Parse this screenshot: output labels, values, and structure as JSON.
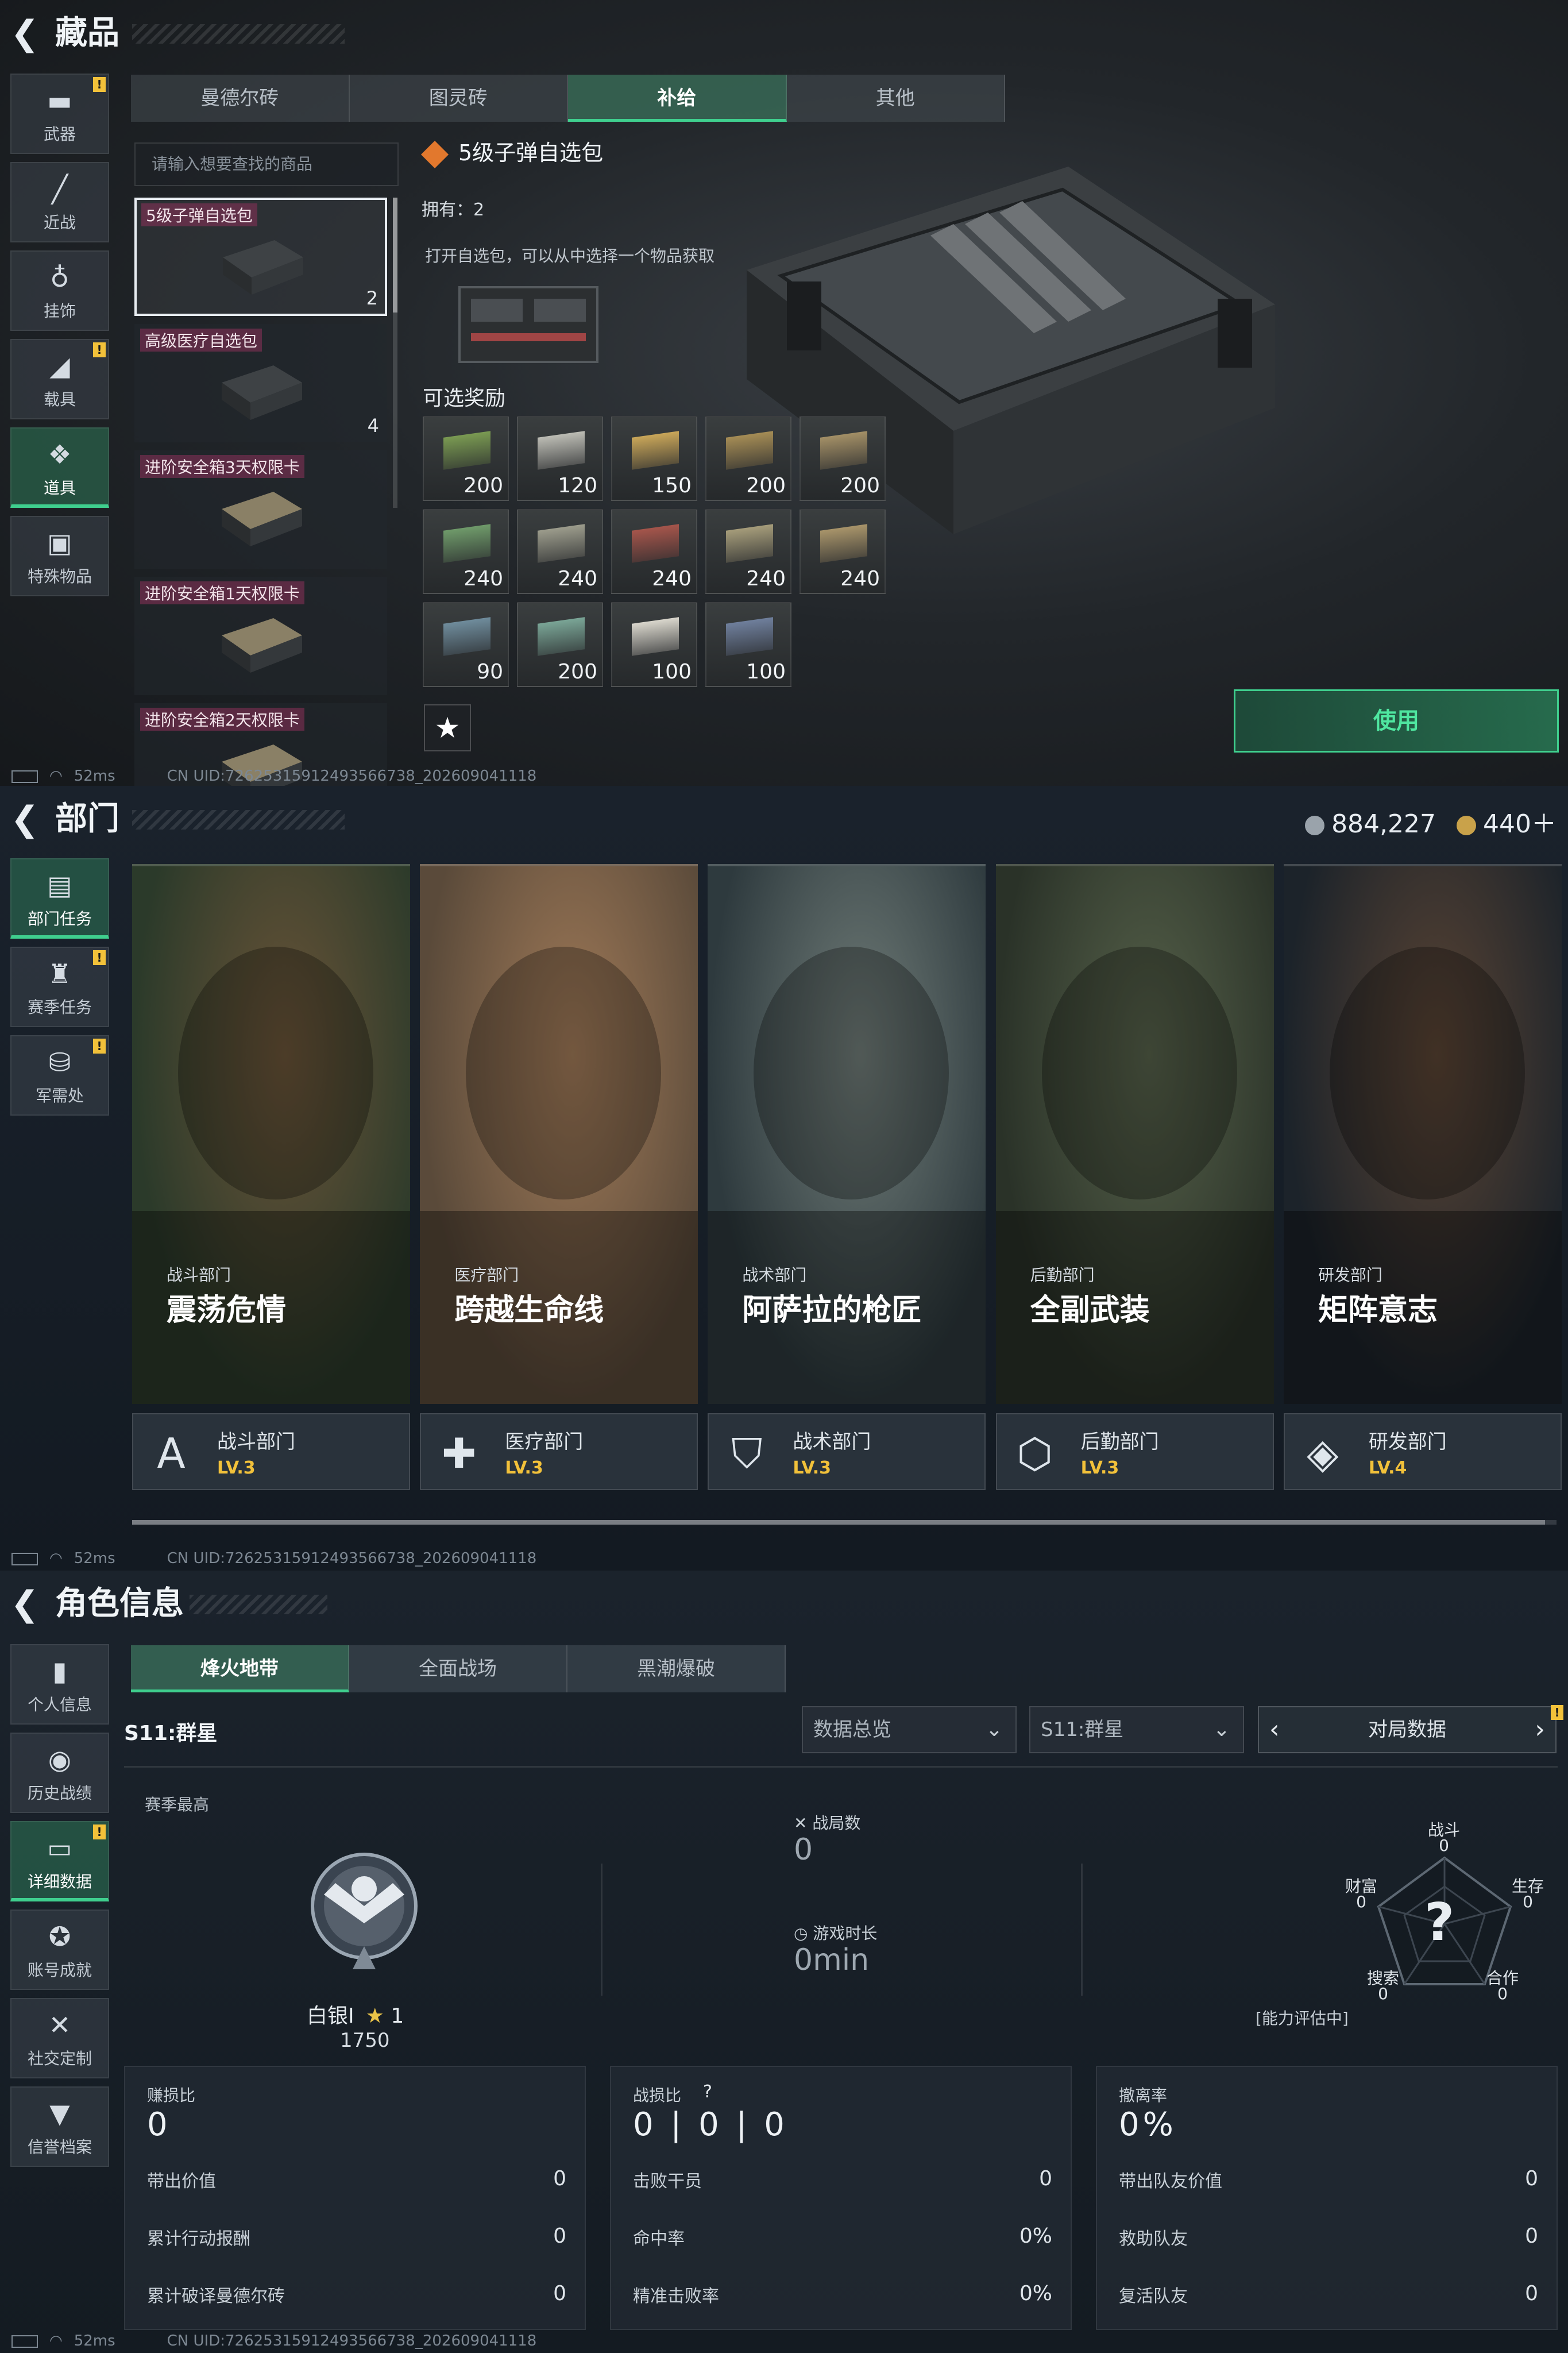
{
  "common": {
    "footer_ping": "52ms",
    "footer_uid": "CN UID:7262531591249356673­8_202609041118"
  },
  "p1": {
    "title": "藏品",
    "side": [
      {
        "icon": "pistol-icon",
        "glyph": "▬",
        "label": "武器",
        "badge": "!",
        "active": false
      },
      {
        "icon": "knife-icon",
        "glyph": "╱",
        "label": "近战",
        "badge": "",
        "active": false
      },
      {
        "icon": "charm-icon",
        "glyph": "♁",
        "label": "挂饰",
        "badge": "",
        "active": false
      },
      {
        "icon": "vehicle-icon",
        "glyph": "◢",
        "label": "载具",
        "badge": "!",
        "active": false
      },
      {
        "icon": "items-icon",
        "glyph": "❖",
        "label": "道具",
        "badge": "",
        "active": true
      },
      {
        "icon": "briefcase-icon",
        "glyph": "▣",
        "label": "特殊物品",
        "badge": "",
        "active": false
      }
    ],
    "tabs": [
      "曼德尔砖",
      "图灵砖",
      "补给",
      "其他"
    ],
    "active_tab": 2,
    "search_placeholder": "请输入想要查找的商品",
    "list": [
      {
        "name": "5级子弹自选包",
        "count": "2",
        "selected": true
      },
      {
        "name": "高级医疗自选包",
        "count": "4",
        "selected": false
      },
      {
        "name": "进阶安全箱3天权限卡",
        "count": "",
        "selected": false
      },
      {
        "name": "进阶安全箱1天权限卡",
        "count": "",
        "selected": false
      },
      {
        "name": "进阶安全箱2天权限卡",
        "count": "",
        "selected": false
      }
    ],
    "item_title": "5级子弹自选包",
    "owned": "拥有：2",
    "desc": "打开自选包，可以从中选择一个物品获取",
    "rewards_title": "可选奖励",
    "rewards": [
      {
        "qty": "200",
        "color": "#7a9a52"
      },
      {
        "qty": "120",
        "color": "#bcbcb4"
      },
      {
        "qty": "150",
        "color": "#c9a659"
      },
      {
        "qty": "200",
        "color": "#a58c55"
      },
      {
        "qty": "200",
        "color": "#a38f66"
      },
      {
        "qty": "240",
        "color": "#6f9a6a"
      },
      {
        "qty": "240",
        "color": "#9c9c8c"
      },
      {
        "qty": "240",
        "color": "#a5554b"
      },
      {
        "qty": "240",
        "color": "#a59c7a"
      },
      {
        "qty": "240",
        "color": "#a8946a"
      },
      {
        "qty": "90",
        "color": "#6f8c9c"
      },
      {
        "qty": "200",
        "color": "#7aa596"
      },
      {
        "qty": "100",
        "color": "#d9d6cc"
      },
      {
        "qty": "100",
        "color": "#6f7f9c"
      }
    ],
    "fav_glyph": "★",
    "use_label": "使用"
  },
  "p2": {
    "title": "部门",
    "currency1": "884,227",
    "currency2": "440＋",
    "side": [
      {
        "icon": "department-task-icon",
        "glyph": "▤",
        "label": "部门任务",
        "badge": "",
        "active": true
      },
      {
        "icon": "season-task-icon",
        "glyph": "♜",
        "label": "赛季任务",
        "badge": "!",
        "active": false
      },
      {
        "icon": "military-supply-icon",
        "glyph": "⛁",
        "label": "军需处",
        "badge": "!",
        "active": false
      }
    ],
    "cards": [
      {
        "sub": "战斗部门",
        "title": "震荡危情",
        "dept": "战斗部门",
        "level": "LV.3",
        "glyph": "A",
        "bg1": "#2b3a2a",
        "bg2": "#6a5438"
      },
      {
        "sub": "医疗部门",
        "title": "跨越生命线",
        "dept": "医疗部门",
        "level": "LV.3",
        "glyph": "✚",
        "bg1": "#5a4a3a",
        "bg2": "#a07a58"
      },
      {
        "sub": "战术部门",
        "title": "阿萨拉的枪匠",
        "dept": "战术部门",
        "level": "LV.3",
        "glyph": "⛉",
        "bg1": "#2e3a3e",
        "bg2": "#707c78"
      },
      {
        "sub": "后勤部门",
        "title": "全副武装",
        "dept": "后勤部门",
        "level": "LV.3",
        "glyph": "⬡",
        "bg1": "#2a3228",
        "bg2": "#56614a"
      },
      {
        "sub": "研发部门",
        "title": "矩阵意志",
        "dept": "研发部门",
        "level": "LV.4",
        "glyph": "◈",
        "bg1": "#1c232a",
        "bg2": "#5a4434"
      }
    ]
  },
  "p3": {
    "title": "角色信息",
    "side": [
      {
        "icon": "personal-info-icon",
        "glyph": "▮",
        "label": "个人信息",
        "badge": "",
        "active": false
      },
      {
        "icon": "history-icon",
        "glyph": "◉",
        "label": "历史战绩",
        "badge": "",
        "active": false
      },
      {
        "icon": "detail-data-icon",
        "glyph": "▭",
        "label": "详细数据",
        "badge": "!",
        "active": true
      },
      {
        "icon": "achievement-icon",
        "glyph": "✪",
        "label": "账号成就",
        "badge": "",
        "active": false
      },
      {
        "icon": "social-icon",
        "glyph": "✕",
        "label": "社交定制",
        "badge": "",
        "active": false
      },
      {
        "icon": "reputation-icon",
        "glyph": "▼",
        "label": "信誉档案",
        "badge": "",
        "active": false
      }
    ],
    "tabs": [
      "烽火地带",
      "全面战场",
      "黑潮爆破"
    ],
    "active_tab": 0,
    "season": "S11:群星",
    "dropdown1": "数据总览",
    "dropdown2": "S11:群星",
    "pager_label": "对局数据",
    "season_high": "赛季最高",
    "rank_name": "白银I",
    "rank_stars": "1",
    "rank_points": "1750",
    "matches_label": "战局数",
    "matches_value": "0",
    "time_label": "游戏时长",
    "time_value": "0min",
    "radar": {
      "combat": "战斗",
      "combat_v": "0",
      "wealth": "财富",
      "wealth_v": "0",
      "survival": "生存",
      "survival_v": "0",
      "search": "搜索",
      "search_v": "0",
      "coop": "合作",
      "coop_v": "0",
      "center": "?",
      "note": "[能力评估中]"
    },
    "boxes": [
      {
        "title": "赚损比",
        "value": "0",
        "rows": [
          {
            "k": "带出价值",
            "v": "0"
          },
          {
            "k": "累计行动报酬",
            "v": "0"
          },
          {
            "k": "累计破译曼德尔砖",
            "v": "0"
          }
        ]
      },
      {
        "title": "战损比",
        "value": "0 | 0 | 0",
        "rows": [
          {
            "k": "击败干员",
            "v": "0"
          },
          {
            "k": "命中率",
            "v": "0%"
          },
          {
            "k": "精准击败率",
            "v": "0%"
          }
        ]
      },
      {
        "title": "撤离率",
        "value": "0%",
        "rows": [
          {
            "k": "带出队友价值",
            "v": "0"
          },
          {
            "k": "救助队友",
            "v": "0"
          },
          {
            "k": "复活队友",
            "v": "0"
          }
        ]
      }
    ]
  }
}
